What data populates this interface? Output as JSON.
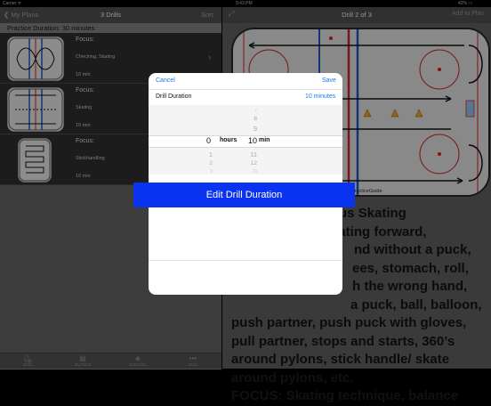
{
  "status": {
    "carrier": "Carrier ᯤ",
    "time": "9:43 PM",
    "battery": "42% ▭"
  },
  "left_nav": {
    "back": "❮ My Plans",
    "title": "3 Drills",
    "sort": "Sort"
  },
  "practice_duration": "Practice Duration: 30 minutes",
  "drills": [
    {
      "focus": "Focus:",
      "skill": "Checking, Skating",
      "minutes": "10  min"
    },
    {
      "focus": "Focus:",
      "skill": "Skating",
      "minutes": "10  min"
    },
    {
      "focus": "Focus:",
      "skill": "Stickhandling",
      "minutes": "10  min"
    }
  ],
  "tabs": [
    {
      "icon": "skater-icon",
      "glyph": "⛸",
      "label": "Drills"
    },
    {
      "icon": "plans-icon",
      "glyph": "▤",
      "label": "My Plans"
    },
    {
      "icon": "subscribe-icon",
      "glyph": "◈",
      "label": "Subscribe"
    },
    {
      "icon": "more-icon",
      "glyph": "•••",
      "label": "More"
    }
  ],
  "right_nav": {
    "title": "Drill 2 of 3",
    "add": "Add to Plan"
  },
  "watermark": "PracticeGuide",
  "description_lines": [
    "us Skating",
    "kating forward,",
    "nd without a puck,",
    "ees, stomach, roll,",
    "h the wrong hand,",
    "a puck, ball, balloon,",
    "push partner, push puck with gloves,",
    "pull partner, stops and starts, 360’s",
    "around pylons, stick handle/ skate",
    "around pylons, etc.",
    "FOCUS: Skating technique, balance"
  ],
  "modal": {
    "cancel": "Cancel",
    "save": "Save",
    "row_label": "Drill Duration",
    "row_value": "10 minutes",
    "hours": {
      "above": [],
      "selected": "0",
      "below": [
        "1",
        "2",
        "3"
      ],
      "label": "hours"
    },
    "minutes": {
      "above": [
        "7",
        "8",
        "9"
      ],
      "selected": "10",
      "below": [
        "11",
        "12",
        "13"
      ],
      "label": "min"
    }
  },
  "banner": "Edit Drill Duration",
  "colors": {
    "accent": "#1a7be6",
    "banner": "#0a33f0",
    "rink_blue": "#1c52b5",
    "rink_red": "#c21f22"
  }
}
